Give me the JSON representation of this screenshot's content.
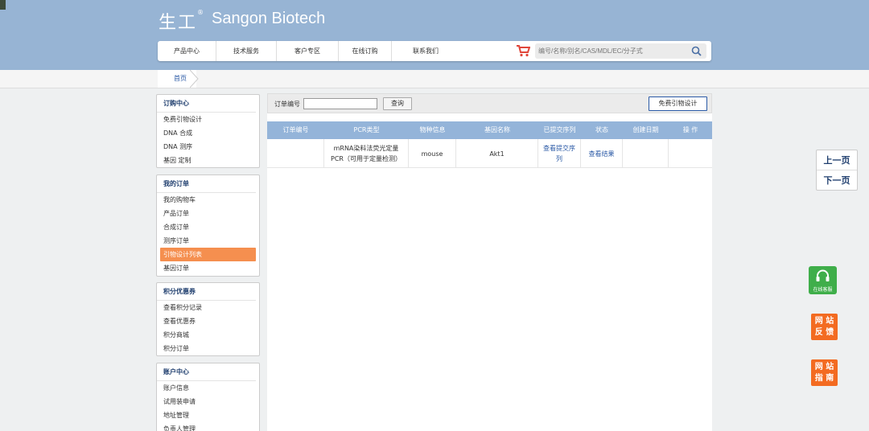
{
  "header": {
    "logo_cn": "生工",
    "logo_reg": "®",
    "logo_en": "Sangon Biotech",
    "nav": [
      "产品中心",
      "技术服务",
      "客户专区",
      "在线订购",
      "联系我们"
    ],
    "search_placeholder": "编号/名称/别名/CAS/MDL/EC/分子式"
  },
  "breadcrumb": {
    "home": "首页"
  },
  "sidebar": {
    "groups": [
      {
        "title": "订购中心",
        "items": [
          "免费引物设计",
          "DNA 合成",
          "DNA 测序",
          "基因 定制"
        ]
      },
      {
        "title": "我的订单",
        "items": [
          "我的购物车",
          "产品订单",
          "合成订单",
          "测序订单",
          "引物设计列表",
          "基因订单"
        ],
        "active": 4
      },
      {
        "title": "积分优惠券",
        "items": [
          "查看积分记录",
          "查看优惠券",
          "积分商城",
          "积分订单"
        ]
      },
      {
        "title": "账户中心",
        "items": [
          "账户信息",
          "试用装申请",
          "地址管理",
          "负责人管理"
        ]
      }
    ]
  },
  "filter": {
    "label": "订单编号",
    "order_value": "",
    "query_label": "查询",
    "primer_design_label": "免费引物设计"
  },
  "table": {
    "headers": [
      "订单编号",
      "PCR类型",
      "物种信息",
      "基因名称",
      "已提交序列",
      "状态",
      "创建日期",
      "操 作"
    ],
    "rows": [
      {
        "order_no": "",
        "pcr_type": "mRNA染料法荧光定量PCR（可用于定量检测）",
        "species": "mouse",
        "gene": "Akt1",
        "sequence_link": "查看提交序列",
        "status_link": "查看结果",
        "date": "",
        "action": ""
      }
    ]
  },
  "pager": {
    "prev": "上一页",
    "next": "下一页"
  },
  "floating": {
    "customer_service": "在线客服",
    "feedback": [
      "网 站",
      "反 馈"
    ],
    "guide": [
      "网 站",
      "指 南"
    ]
  },
  "colors": {
    "header_bg": "#97b4d4",
    "table_header": "#94b4d9",
    "active_item": "#f58f4f",
    "cs_green": "#3fae4a",
    "orange": "#f36b21"
  }
}
